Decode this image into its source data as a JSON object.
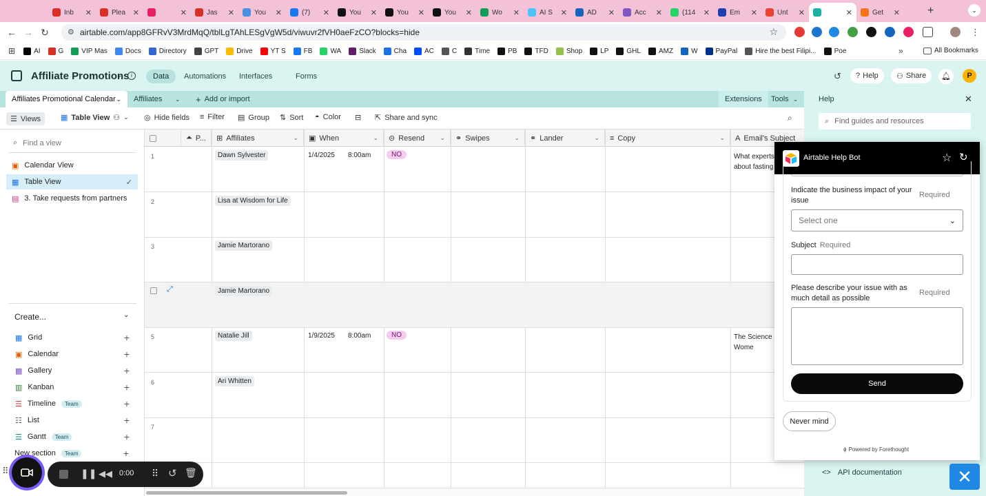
{
  "browser": {
    "tabs": [
      {
        "title": "Inb",
        "color": "#d93025"
      },
      {
        "title": "Plea",
        "color": "#d93025"
      },
      {
        "title": "",
        "color": "#e91e63"
      },
      {
        "title": "Jas",
        "color": "#d93025"
      },
      {
        "title": "You",
        "color": "#4a90e2"
      },
      {
        "title": "(7)",
        "color": "#1877f2"
      },
      {
        "title": "You",
        "color": "#111111"
      },
      {
        "title": "You",
        "color": "#111111"
      },
      {
        "title": "You",
        "color": "#111111"
      },
      {
        "title": "Wo",
        "color": "#0f9d58"
      },
      {
        "title": "AI S",
        "color": "#4fc3f7"
      },
      {
        "title": "AD",
        "color": "#1565c0"
      },
      {
        "title": "Acc",
        "color": "#7e57c2"
      },
      {
        "title": "(114",
        "color": "#25d366"
      },
      {
        "title": "Em",
        "color": "#1e40af"
      },
      {
        "title": "Unt",
        "color": "#ea4335"
      },
      {
        "title": "",
        "color": "#19b1a2"
      },
      {
        "title": "Get",
        "color": "#f97316"
      }
    ],
    "url": "airtable.com/app8GFRvV3MrdMqQ/tblLgTAhLESgVgW5d/viwuvr2fVH0aeFzCO?blocks=hide",
    "bookmarks": [
      {
        "label": "AI",
        "color": "#000000"
      },
      {
        "label": "G",
        "color": "#d93025"
      },
      {
        "label": "VIP Mas",
        "color": "#0f9d58"
      },
      {
        "label": "Docs",
        "color": "#4285f4"
      },
      {
        "label": "Directory",
        "color": "#3367d6"
      },
      {
        "label": "GPT",
        "color": "#444444"
      },
      {
        "label": "Drive",
        "color": "#fbbc04"
      },
      {
        "label": "YT S",
        "color": "#ff0000"
      },
      {
        "label": "FB",
        "color": "#1877f2"
      },
      {
        "label": "WA",
        "color": "#25d366"
      },
      {
        "label": "Slack",
        "color": "#611f69"
      },
      {
        "label": "Cha",
        "color": "#1a73e8"
      },
      {
        "label": "AC",
        "color": "#004cff"
      },
      {
        "label": "C",
        "color": "#555555"
      },
      {
        "label": "Time",
        "color": "#333333"
      },
      {
        "label": "PB",
        "color": "#111111"
      },
      {
        "label": "TFD",
        "color": "#111111"
      },
      {
        "label": "Shop",
        "color": "#95bf47"
      },
      {
        "label": "LP",
        "color": "#111111"
      },
      {
        "label": "GHL",
        "color": "#111111"
      },
      {
        "label": "AMZ",
        "color": "#111111"
      },
      {
        "label": "W",
        "color": "#1565c0"
      },
      {
        "label": "PayPal",
        "color": "#003087"
      },
      {
        "label": "Hire the best Filipi...",
        "color": "#555555"
      },
      {
        "label": "Poe",
        "color": "#111111"
      }
    ],
    "all_bookmarks": "All Bookmarks"
  },
  "header": {
    "base_name": "Affiliate Promotions",
    "nav": [
      "Data",
      "Automations",
      "Interfaces",
      "Forms"
    ],
    "help": "Help",
    "share": "Share",
    "avatar": "P"
  },
  "tables": {
    "active": "Affiliates Promotional Calendar",
    "other": "Affiliates",
    "add": "Add or import",
    "extensions": "Extensions",
    "tools": "Tools"
  },
  "toolbar": {
    "views": "Views",
    "view_name": "Table View",
    "hide_fields": "Hide fields",
    "filter": "Filter",
    "group": "Group",
    "sort": "Sort",
    "color": "Color",
    "share_sync": "Share and sync"
  },
  "sidebar": {
    "find_placeholder": "Find a view",
    "views": [
      "Calendar View",
      "Table View",
      "3. Take requests from partners"
    ],
    "create": "Create...",
    "create_items": [
      {
        "label": "Grid",
        "team": ""
      },
      {
        "label": "Calendar",
        "team": ""
      },
      {
        "label": "Gallery",
        "team": ""
      },
      {
        "label": "Kanban",
        "team": ""
      },
      {
        "label": "Timeline",
        "team": "Team"
      },
      {
        "label": "List",
        "team": ""
      },
      {
        "label": "Gantt",
        "team": "Team"
      }
    ],
    "new_section": "New section",
    "new_section_team": "Team"
  },
  "grid": {
    "columns": [
      "P...",
      "Affiliates",
      "When",
      "Resend",
      "Swipes",
      "Lander",
      "Copy",
      "Email's Subject"
    ],
    "rows": [
      {
        "n": "1",
        "affiliate": "Dawn Sylvester",
        "date": "1/4/2025",
        "time": "8:00am",
        "resend": "NO",
        "subject": "What experts saying about fasting"
      },
      {
        "n": "2",
        "affiliate": "Lisa at Wisdom for Life",
        "date": "",
        "time": "",
        "resend": "",
        "subject": ""
      },
      {
        "n": "3",
        "affiliate": "Jamie Martorano",
        "date": "",
        "time": "",
        "resend": "",
        "subject": ""
      },
      {
        "n": "",
        "affiliate": "Jamie Martorano",
        "date": "",
        "time": "",
        "resend": "",
        "subject": ""
      },
      {
        "n": "5",
        "affiliate": "Natalie Jill",
        "date": "1/9/2025",
        "time": "8:00am",
        "resend": "NO",
        "subject": "The Science Loss in Wome"
      },
      {
        "n": "6",
        "affiliate": "Ari Whitten",
        "date": "",
        "time": "",
        "resend": "",
        "subject": ""
      },
      {
        "n": "7",
        "affiliate": "",
        "date": "",
        "time": "",
        "resend": "",
        "subject": ""
      }
    ]
  },
  "help": {
    "title": "Help",
    "search_placeholder": "Find guides and resources",
    "bot_title": "Airtable Help Bot",
    "impact_label": "Indicate the business impact of your issue",
    "required": "Required",
    "select_placeholder": "Select one",
    "subject_label": "Subject",
    "describe_label": "Please describe your issue with as much detail as possible",
    "send": "Send",
    "never_mind": "Never mind",
    "powered": "Powered by Forethought",
    "api_doc": "API documentation"
  },
  "recorder": {
    "time": "0:00"
  }
}
